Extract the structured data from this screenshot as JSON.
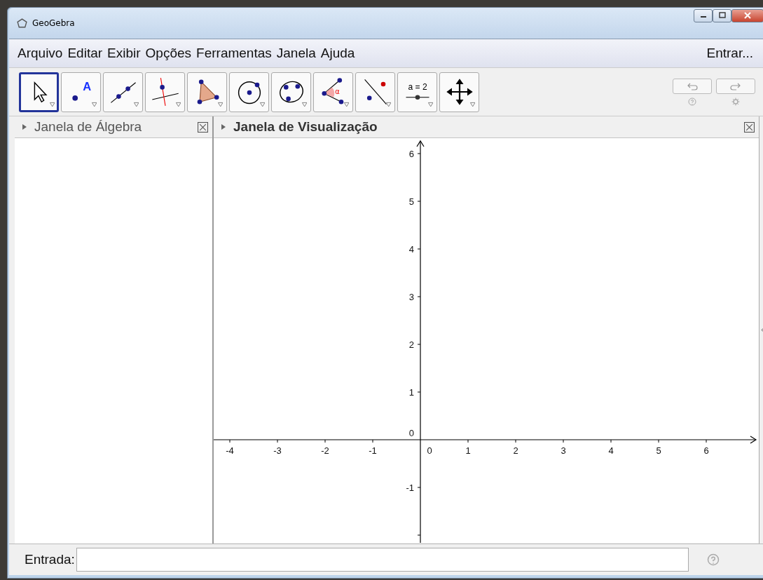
{
  "window": {
    "title": "GeoGebra"
  },
  "menu": {
    "items": [
      "Arquivo",
      "Editar",
      "Exibir",
      "Opções",
      "Ferramentas",
      "Janela",
      "Ajuda"
    ],
    "login": "Entrar..."
  },
  "toolbar": {
    "tools": [
      {
        "kind": "move",
        "selected": true
      },
      {
        "kind": "point",
        "selected": false,
        "text": "A"
      },
      {
        "kind": "line",
        "selected": false
      },
      {
        "kind": "perpendicular",
        "selected": false
      },
      {
        "kind": "polygon",
        "selected": false
      },
      {
        "kind": "circle",
        "selected": false
      },
      {
        "kind": "conic",
        "selected": false
      },
      {
        "kind": "angle",
        "selected": false,
        "text": "α"
      },
      {
        "kind": "reflect",
        "selected": false
      },
      {
        "kind": "slider",
        "selected": false,
        "text": "a = 2"
      },
      {
        "kind": "pan",
        "selected": false
      }
    ]
  },
  "algebra_view": {
    "title": "Janela de Álgebra"
  },
  "graphics_view": {
    "title": "Janela de Visualização",
    "x_labels": [
      "-4",
      "-3",
      "-2",
      "-1",
      "0",
      "1",
      "2",
      "3",
      "4",
      "5",
      "6"
    ],
    "y_labels": [
      "6",
      "5",
      "4",
      "3",
      "2",
      "1",
      "0",
      "-1"
    ]
  },
  "input_bar": {
    "label": "Entrada:"
  }
}
